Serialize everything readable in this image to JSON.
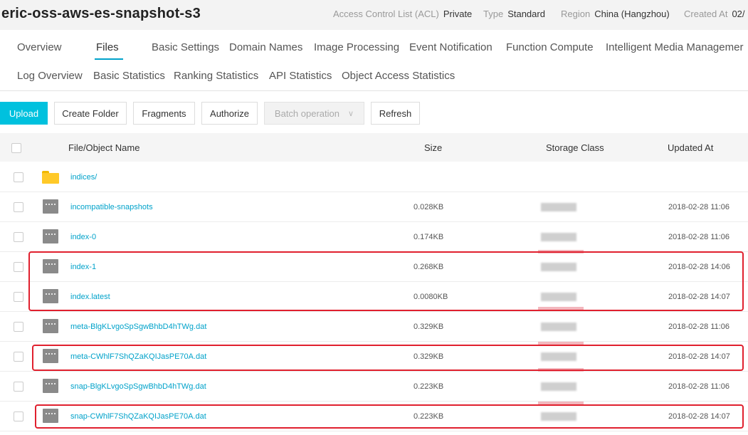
{
  "bucket": {
    "title": "eric-oss-aws-es-snapshot-s3",
    "meta": [
      {
        "key": "Access Control List (ACL)",
        "value": "Private"
      },
      {
        "key": "Type",
        "value": "Standard"
      },
      {
        "key": "Region",
        "value": "China (Hangzhou)"
      },
      {
        "key": "Created At",
        "value": "02/"
      }
    ]
  },
  "tabs_row1": [
    "Overview",
    "Files",
    "Basic Settings",
    "Domain Names",
    "Image Processing",
    "Event Notification",
    "Function Compute",
    "Intelligent Media Managemer"
  ],
  "tabs_row2": [
    "Log Overview",
    "Basic Statistics",
    "Ranking Statistics",
    "API Statistics",
    "Object Access Statistics"
  ],
  "active_tab": "Files",
  "toolbar": {
    "upload": "Upload",
    "create_folder": "Create Folder",
    "fragments": "Fragments",
    "authorize": "Authorize",
    "batch_operation": "Batch operation",
    "refresh": "Refresh"
  },
  "table": {
    "columns": {
      "name": "File/Object Name",
      "size": "Size",
      "storage_class": "Storage Class",
      "updated_at": "Updated At"
    },
    "rows": [
      {
        "name": "indices/",
        "size": "",
        "updated": "",
        "type": "folder"
      },
      {
        "name": "incompatible-snapshots",
        "size": "0.028KB",
        "updated": "2018-02-28 11:06",
        "type": "file"
      },
      {
        "name": "index-0",
        "size": "0.174KB",
        "updated": "2018-02-28 11:06",
        "type": "file"
      },
      {
        "name": "index-1",
        "size": "0.268KB",
        "updated": "2018-02-28 14:06",
        "type": "file"
      },
      {
        "name": "index.latest",
        "size": "0.0080KB",
        "updated": "2018-02-28 14:07",
        "type": "file"
      },
      {
        "name": "meta-BlgKLvgoSpSgwBhbD4hTWg.dat",
        "size": "0.329KB",
        "updated": "2018-02-28 11:06",
        "type": "file"
      },
      {
        "name": "meta-CWhlF7ShQZaKQIJasPE70A.dat",
        "size": "0.329KB",
        "updated": "2018-02-28 14:07",
        "type": "file"
      },
      {
        "name": "snap-BlgKLvgoSpSgwBhbD4hTWg.dat",
        "size": "0.223KB",
        "updated": "2018-02-28 11:06",
        "type": "file"
      },
      {
        "name": "snap-CWhlF7ShQZaKQIJasPE70A.dat",
        "size": "0.223KB",
        "updated": "2018-02-28 14:07",
        "type": "file"
      }
    ]
  },
  "colors": {
    "accent": "#00c1de",
    "link": "#00a2ca",
    "highlight": "#e0202e"
  }
}
